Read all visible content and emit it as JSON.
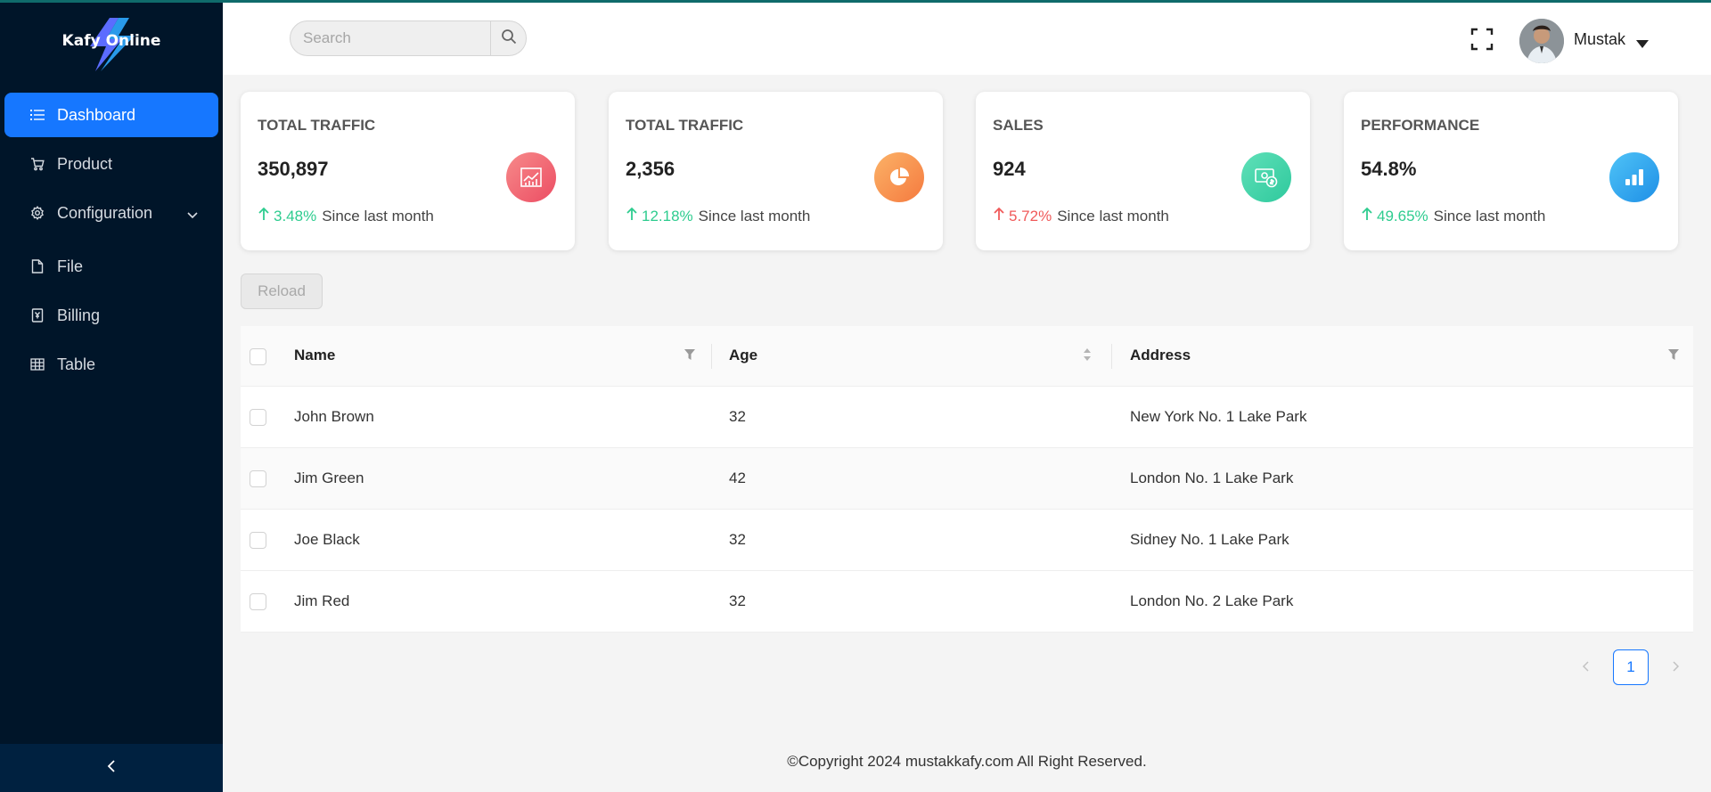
{
  "app": {
    "logo_text": "Kafy Online",
    "accent_color": "#1677ff",
    "sidebar_color": "#001529"
  },
  "sidebar": {
    "items": [
      {
        "label": "Dashboard",
        "icon": "list-icon",
        "active": true
      },
      {
        "label": "Product",
        "icon": "cart-icon"
      },
      {
        "label": "Configuration",
        "icon": "gear-icon",
        "has_submenu": true
      },
      {
        "label": "File",
        "icon": "file-icon"
      },
      {
        "label": "Billing",
        "icon": "billing-icon"
      },
      {
        "label": "Table",
        "icon": "table-icon"
      }
    ],
    "collapse_icon": "chevron-left-icon"
  },
  "header": {
    "search_placeholder": "Search",
    "search_value": "",
    "fullscreen_icon": "fullscreen-icon",
    "user_name": "Mustak"
  },
  "stats": [
    {
      "title": "TOTAL TRAFFIC",
      "value": "350,897",
      "change": "3.48%",
      "direction": "up",
      "change_color": "#2ecc8f",
      "note": "Since last month",
      "icon": "line-chart-icon",
      "icon_color": "#f05a6b"
    },
    {
      "title": "TOTAL TRAFFIC",
      "value": "2,356",
      "change": "12.18%",
      "direction": "up",
      "change_color": "#2ecc8f",
      "note": "Since last month",
      "icon": "pie-chart-icon",
      "icon_color": "#f98a4b"
    },
    {
      "title": "SALES",
      "value": "924",
      "change": "5.72%",
      "direction": "up",
      "change_color": "#f05a5a",
      "note": "Since last month",
      "icon": "money-icon",
      "icon_color": "#35d2a4"
    },
    {
      "title": "PERFORMANCE",
      "value": "54.8%",
      "change": "49.65%",
      "direction": "up",
      "change_color": "#2ecc8f",
      "note": "Since last month",
      "icon": "bar-chart-icon",
      "icon_color": "#1ea3ea"
    }
  ],
  "toolbar": {
    "reload_label": "Reload"
  },
  "table": {
    "columns": [
      {
        "label": "Name",
        "control": "filter-icon"
      },
      {
        "label": "Age",
        "control": "sort-icon"
      },
      {
        "label": "Address",
        "control": "filter-icon"
      }
    ],
    "rows": [
      {
        "name": "John Brown",
        "age": "32",
        "address": "New York No. 1 Lake Park"
      },
      {
        "name": "Jim Green",
        "age": "42",
        "address": "London No. 1 Lake Park"
      },
      {
        "name": "Joe Black",
        "age": "32",
        "address": "Sidney No. 1 Lake Park"
      },
      {
        "name": "Jim Red",
        "age": "32",
        "address": "London No. 2 Lake Park"
      }
    ]
  },
  "pagination": {
    "current": "1"
  },
  "footer": {
    "text": "©Copyright 2024 mustakkafy.com All Right Reserved."
  }
}
